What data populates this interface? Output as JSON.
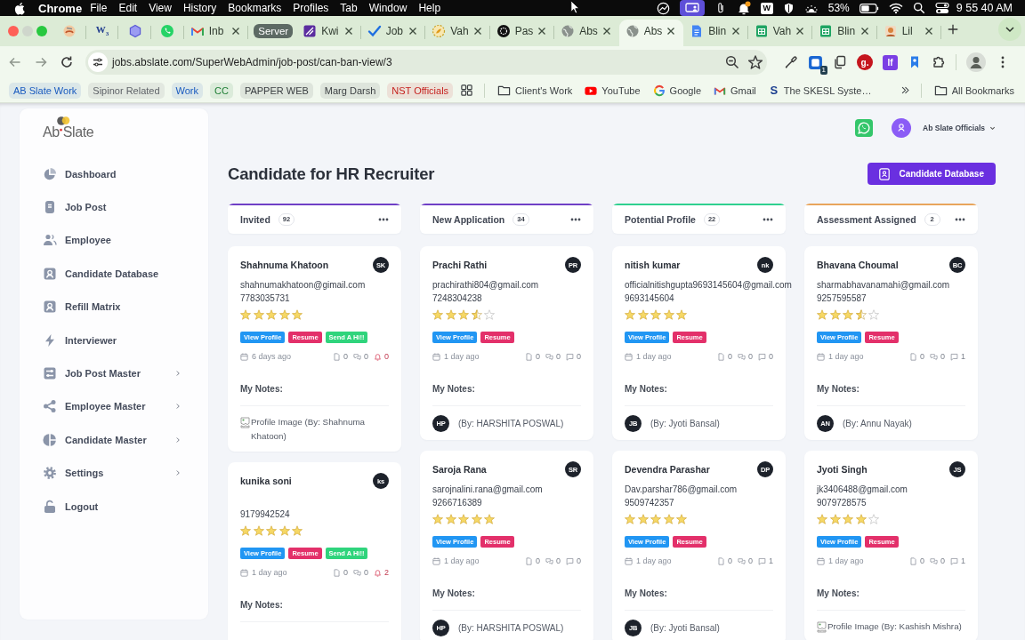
{
  "menu_bar": {
    "app": "Chrome",
    "menus": [
      "File",
      "Edit",
      "View",
      "History",
      "Bookmarks",
      "Profiles",
      "Tab",
      "Window",
      "Help"
    ],
    "status_badge": "W",
    "battery": "53%",
    "clock": "9 55 40 AM"
  },
  "tabs": [
    {
      "kind": "pinned",
      "selected": false
    },
    {
      "kind": "pinned",
      "label": "W$_{3}$",
      "selected": false
    },
    {
      "kind": "pinned",
      "selected": false
    },
    {
      "kind": "pinned",
      "selected": false
    },
    {
      "kind": "tab",
      "title": "Inb",
      "selected": false
    },
    {
      "kind": "group",
      "label": "Server"
    },
    {
      "kind": "tab",
      "title": "Kwi",
      "selected": false
    },
    {
      "kind": "tab",
      "title": "Job",
      "selected": false
    },
    {
      "kind": "tab",
      "title": "Vah",
      "selected": false
    },
    {
      "kind": "tab",
      "title": "Pas",
      "selected": false
    },
    {
      "kind": "tab",
      "title": "Abs",
      "selected": false
    },
    {
      "kind": "tab",
      "title": "Abs",
      "selected": true
    },
    {
      "kind": "tab",
      "title": "Blin",
      "selected": false
    },
    {
      "kind": "tab",
      "title": "Vah",
      "selected": false
    },
    {
      "kind": "tab",
      "title": "Blin",
      "selected": false
    },
    {
      "kind": "tab",
      "title": "Lil",
      "selected": false
    }
  ],
  "toolbar": {
    "url": "jobs.abslate.com/SuperWebAdmin/job-post/can-ban-view/3",
    "extension_badge": "1",
    "extension_letters": [
      "g.",
      "lf"
    ]
  },
  "bookmarks_bar": {
    "groups": [
      {
        "label": "AB Slate Work",
        "color": "#1a5bbf"
      },
      {
        "label": "Sipinor Related",
        "color": "#5f6368"
      },
      {
        "label": "Work",
        "color": "#1a5bbf"
      },
      {
        "label": "CC",
        "color": "#1e7e34"
      },
      {
        "label": "PAPPER WEB",
        "color": "#3c4043"
      },
      {
        "label": "Marg Darsh",
        "color": "#3c4043"
      },
      {
        "label": "NST Officials",
        "color": "#c5221f"
      }
    ],
    "bookmarks": [
      {
        "kind": "folder",
        "label": "Client's Work"
      },
      {
        "kind": "link",
        "label": "YouTube"
      },
      {
        "kind": "link",
        "label": "Google"
      },
      {
        "kind": "link",
        "label": "Gmail"
      },
      {
        "kind": "link",
        "icon_letter": "S",
        "label": "The SKESL Syste…"
      }
    ],
    "all_bookmarks": "All Bookmarks"
  },
  "sidebar": {
    "logo": "Ab Slate",
    "items": [
      {
        "label": "Dashboard",
        "selected": false,
        "expandable": false
      },
      {
        "label": "Job Post",
        "selected": false,
        "expandable": false
      },
      {
        "label": "Employee",
        "selected": false,
        "expandable": false
      },
      {
        "label": "Candidate Database",
        "selected": false,
        "expandable": false
      },
      {
        "label": "Refill Matrix",
        "selected": false,
        "expandable": false
      },
      {
        "label": "Interviewer",
        "selected": false,
        "expandable": false
      },
      {
        "label": "Job Post Master",
        "selected": false,
        "expandable": true
      },
      {
        "label": "Employee Master",
        "selected": false,
        "expandable": true
      },
      {
        "label": "Candidate Master",
        "selected": false,
        "expandable": true
      },
      {
        "label": "Settings",
        "selected": false,
        "expandable": true
      },
      {
        "label": "Logout",
        "selected": false,
        "expandable": false
      }
    ]
  },
  "header": {
    "account": "Ab Slate Officials",
    "title": "Candidate for HR Recruiter",
    "action": "Candidate Database"
  },
  "columns": [
    {
      "title": "Invited",
      "count": "92",
      "color": "#6f3fc6",
      "cards": [
        {
          "name": "Shahnuma Khatoon",
          "initials": "SK",
          "email": "shahnumakhatoon@gimail.com",
          "phone": "7783035731",
          "stars": 5,
          "buttons": [
            {
              "kind": "view",
              "label": "View Profile"
            },
            {
              "kind": "resume",
              "label": "Resume"
            },
            {
              "kind": "greet",
              "label": "Send A Hi!!"
            }
          ],
          "time": "6 days ago",
          "counters": [
            {
              "kind": "file",
              "value": "0"
            },
            {
              "kind": "chat",
              "value": "0"
            },
            {
              "kind": "bell",
              "value": "0"
            }
          ],
          "notes_label": "My Notes:",
          "note": {
            "kind": "image",
            "alt": "Profile Image",
            "author": "(By: Shahnuma Khatoon)"
          }
        },
        {
          "name": "kunika soni",
          "initials": "ks",
          "phone": "9179942524",
          "stars": 5,
          "buttons": [
            {
              "kind": "view",
              "label": "View Profile"
            },
            {
              "kind": "resume",
              "label": "Resume"
            },
            {
              "kind": "greet",
              "label": "Send A Hi!!"
            }
          ],
          "time": "1 day ago",
          "counters": [
            {
              "kind": "file",
              "value": "0"
            },
            {
              "kind": "chat",
              "value": "0"
            },
            {
              "kind": "bell",
              "value": "2"
            }
          ],
          "notes_label": "My Notes:"
        }
      ]
    },
    {
      "title": "New Application",
      "count": "34",
      "color": "#6f3fc6",
      "cards": [
        {
          "name": "Prachi Rathi",
          "initials": "PR",
          "email": "prachirathi804@gmail.com",
          "phone": "7248304238",
          "stars": 3.5,
          "buttons": [
            {
              "kind": "view",
              "label": "View Profile"
            },
            {
              "kind": "resume",
              "label": "Resume"
            }
          ],
          "time": "1 day ago",
          "counters": [
            {
              "kind": "file",
              "value": "0"
            },
            {
              "kind": "chat",
              "value": "0"
            },
            {
              "kind": "comment",
              "value": "0"
            }
          ],
          "notes_label": "My Notes:",
          "note": {
            "kind": "avatar",
            "initials": "HP",
            "author": "(By: HARSHITA POSWAL)"
          }
        },
        {
          "name": "Saroja Rana",
          "initials": "SR",
          "email": "sarojnalini.rana@gmail.com",
          "phone": "9266716389",
          "stars": 5,
          "buttons": [
            {
              "kind": "view",
              "label": "View Profile"
            },
            {
              "kind": "resume",
              "label": "Resume"
            }
          ],
          "time": "1 day ago",
          "counters": [
            {
              "kind": "file",
              "value": "0"
            },
            {
              "kind": "chat",
              "value": "0"
            },
            {
              "kind": "comment",
              "value": "0"
            }
          ],
          "notes_label": "My Notes:",
          "note": {
            "kind": "avatar",
            "initials": "HP",
            "author": "(By: HARSHITA POSWAL)"
          }
        }
      ]
    },
    {
      "title": "Potential Profile",
      "count": "22",
      "color": "#2fd08f",
      "cards": [
        {
          "name": "nitish kumar",
          "initials": "nk",
          "email": "officialnitishgupta9693145604@gmail.com",
          "phone": "9693145604",
          "stars": 5,
          "buttons": [
            {
              "kind": "view",
              "label": "View Profile"
            },
            {
              "kind": "resume",
              "label": "Resume"
            }
          ],
          "time": "1 day ago",
          "counters": [
            {
              "kind": "file",
              "value": "0"
            },
            {
              "kind": "chat",
              "value": "0"
            },
            {
              "kind": "comment",
              "value": "0"
            }
          ],
          "notes_label": "My Notes:",
          "note": {
            "kind": "avatar",
            "initials": "JB",
            "author": "(By: Jyoti Bansal)"
          }
        },
        {
          "name": "Devendra Parashar",
          "initials": "DP",
          "email": "Dav.parshar786@gmail.com",
          "phone": "9509742357",
          "stars": 5,
          "buttons": [
            {
              "kind": "view",
              "label": "View Profile"
            },
            {
              "kind": "resume",
              "label": "Resume"
            }
          ],
          "time": "1 day ago",
          "counters": [
            {
              "kind": "file",
              "value": "0"
            },
            {
              "kind": "chat",
              "value": "0"
            },
            {
              "kind": "comment",
              "value": "1"
            }
          ],
          "notes_label": "My Notes:",
          "note": {
            "kind": "avatar",
            "initials": "JB",
            "author": "(By: Jyoti Bansal)"
          }
        }
      ]
    },
    {
      "title": "Assessment Assigned",
      "count": "2",
      "color": "#e8a55c",
      "cards": [
        {
          "name": "Bhavana Choumal",
          "initials": "BC",
          "email": "sharmabhavanamahi@gmail.com",
          "phone": "9257595587",
          "stars": 3.5,
          "buttons": [
            {
              "kind": "view",
              "label": "View Profile"
            },
            {
              "kind": "resume",
              "label": "Resume"
            }
          ],
          "time": "1 day ago",
          "counters": [
            {
              "kind": "file",
              "value": "0"
            },
            {
              "kind": "chat",
              "value": "0"
            },
            {
              "kind": "comment",
              "value": "1"
            }
          ],
          "notes_label": "My Notes:",
          "note": {
            "kind": "avatar",
            "initials": "AN",
            "author": "(By: Annu Nayak)"
          }
        },
        {
          "name": "Jyoti Singh",
          "initials": "JS",
          "email": "jk3406488@gmail.com",
          "phone": "9079728575",
          "stars": 4,
          "buttons": [
            {
              "kind": "view",
              "label": "View Profile"
            },
            {
              "kind": "resume",
              "label": "Resume"
            }
          ],
          "time": "1 day ago",
          "counters": [
            {
              "kind": "file",
              "value": "0"
            },
            {
              "kind": "chat",
              "value": "0"
            },
            {
              "kind": "comment",
              "value": "1"
            }
          ],
          "notes_label": "My Notes:",
          "note": {
            "kind": "image",
            "alt": "Profile Image",
            "author": "(By: Kashish Mishra)"
          }
        }
      ]
    }
  ]
}
